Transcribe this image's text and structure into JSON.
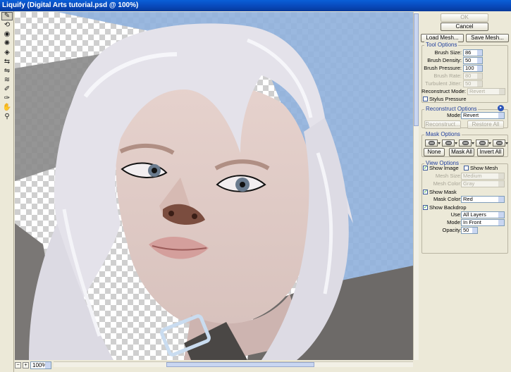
{
  "window": {
    "title": "Liquify (Digital Arts tutorial.psd @ 100%)"
  },
  "tools": [
    {
      "name": "forward-warp-tool-icon",
      "glyph": "✎"
    },
    {
      "name": "reconstruct-tool-icon",
      "glyph": "⟲"
    },
    {
      "name": "twirl-tool-icon",
      "glyph": "◉"
    },
    {
      "name": "pucker-tool-icon",
      "glyph": "✺"
    },
    {
      "name": "bloat-tool-icon",
      "glyph": "◈"
    },
    {
      "name": "push-left-tool-icon",
      "glyph": "⇆"
    },
    {
      "name": "mirror-tool-icon",
      "glyph": "⇋"
    },
    {
      "name": "turbulence-tool-icon",
      "glyph": "≋"
    },
    {
      "name": "freeze-mask-tool-icon",
      "glyph": "✐"
    },
    {
      "name": "thaw-mask-tool-icon",
      "glyph": "✑"
    },
    {
      "name": "hand-tool-icon",
      "glyph": "✋"
    },
    {
      "name": "zoom-tool-icon",
      "glyph": "⚲"
    }
  ],
  "zoom": {
    "value": "100%"
  },
  "buttons": {
    "ok": "OK",
    "cancel": "Cancel",
    "load_mesh": "Load Mesh...",
    "save_mesh": "Save Mesh..."
  },
  "tool_options": {
    "title": "Tool Options",
    "brush_size": {
      "label": "Brush Size:",
      "value": "86"
    },
    "brush_density": {
      "label": "Brush Density:",
      "value": "50"
    },
    "brush_pressure": {
      "label": "Brush Pressure:",
      "value": "100"
    },
    "brush_rate": {
      "label": "Brush Rate:",
      "value": "80"
    },
    "turbulent_jitter": {
      "label": "Turbulent Jitter:",
      "value": "50"
    },
    "reconstruct_mode": {
      "label": "Reconstruct Mode:",
      "value": "Revert"
    },
    "stylus_pressure": "Stylus Pressure"
  },
  "reconstruct_options": {
    "title": "Reconstruct Options",
    "mode_label": "Mode:",
    "mode_value": "Revert",
    "reconstruct_button": "Reconstruct...",
    "restore_all_button": "Restore All"
  },
  "mask_options": {
    "title": "Mask Options",
    "none_button": "None",
    "mask_all_button": "Mask All",
    "invert_all_button": "Invert All"
  },
  "view_options": {
    "title": "View Options",
    "show_image": "Show Image",
    "show_mesh": "Show Mesh",
    "mesh_size_label": "Mesh Size:",
    "mesh_size_value": "Medium",
    "mesh_color_label": "Mesh Color:",
    "mesh_color_value": "Gray",
    "show_mask": "Show Mask",
    "mask_color_label": "Mask Color:",
    "mask_color_value": "Red",
    "show_backdrop": "Show Backdrop",
    "use_label": "Use:",
    "use_value": "All Layers",
    "mode_label": "Mode:",
    "mode_value": "In Front",
    "opacity_label": "Opacity:",
    "opacity_value": "50"
  },
  "colors": {
    "titlebar": "#0847b8",
    "section_title": "#1f3d9c",
    "backdrop_blue": "#8fb0dc"
  }
}
